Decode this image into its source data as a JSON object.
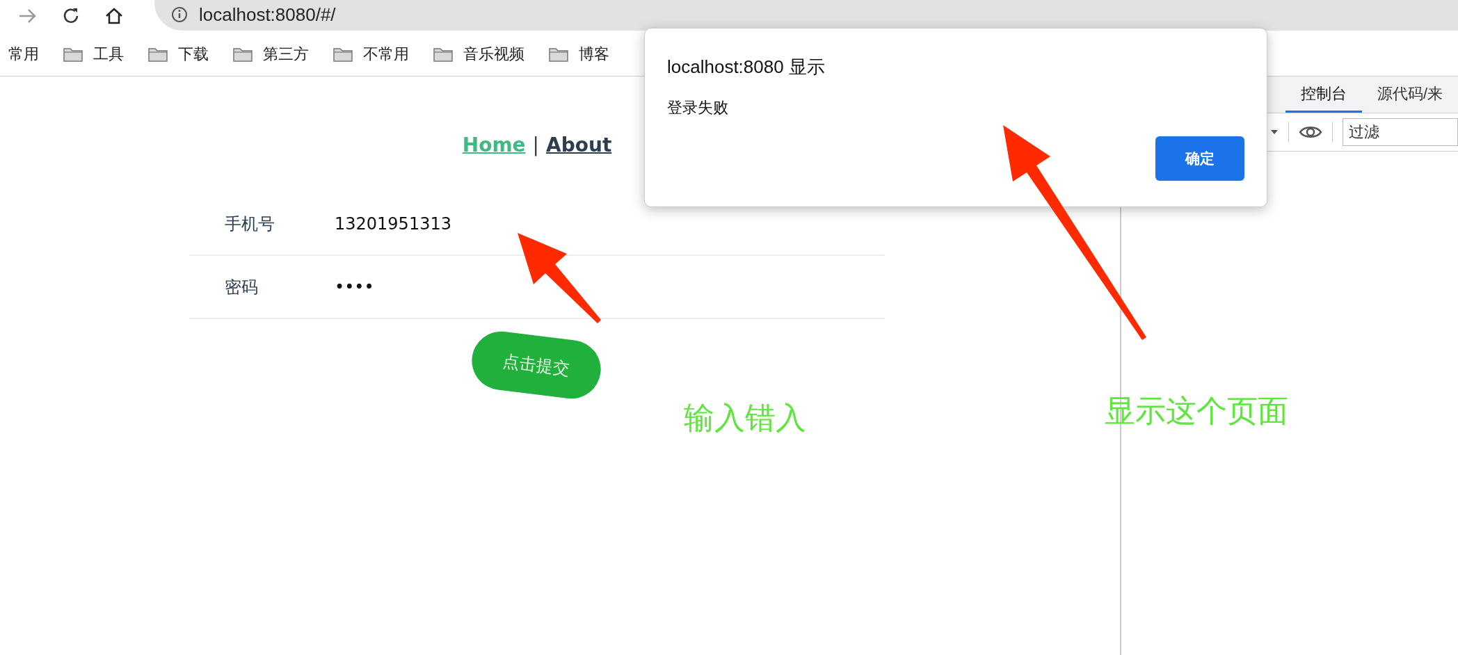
{
  "browser": {
    "address": "localhost:8080/#/",
    "bookmarks": [
      {
        "label": "常用",
        "kind": "plain"
      },
      {
        "label": "工具",
        "kind": "folder"
      },
      {
        "label": "下载",
        "kind": "folder"
      },
      {
        "label": "第三方",
        "kind": "folder"
      },
      {
        "label": "不常用",
        "kind": "folder"
      },
      {
        "label": "音乐视频",
        "kind": "folder"
      },
      {
        "label": "博客",
        "kind": "folder"
      }
    ]
  },
  "page": {
    "nav": [
      {
        "label": "Home",
        "selected": true
      },
      {
        "label": "About",
        "selected": false
      }
    ],
    "separator": "|",
    "form": {
      "fields": [
        {
          "label": "手机号",
          "value": "13201951313"
        },
        {
          "label": "密码",
          "value": "••••"
        }
      ],
      "submit": "点击提交"
    }
  },
  "devtools": {
    "tabs": [
      {
        "label": "控制台",
        "selected": true
      },
      {
        "label": "源代码/来",
        "selected": false
      }
    ],
    "filter_placeholder": "过滤"
  },
  "dialog": {
    "title": "localhost:8080 显示",
    "message": "登录失败",
    "button": "确定"
  },
  "annotations": [
    {
      "text": "输入错入"
    },
    {
      "text": "显示这个页面"
    }
  ]
}
